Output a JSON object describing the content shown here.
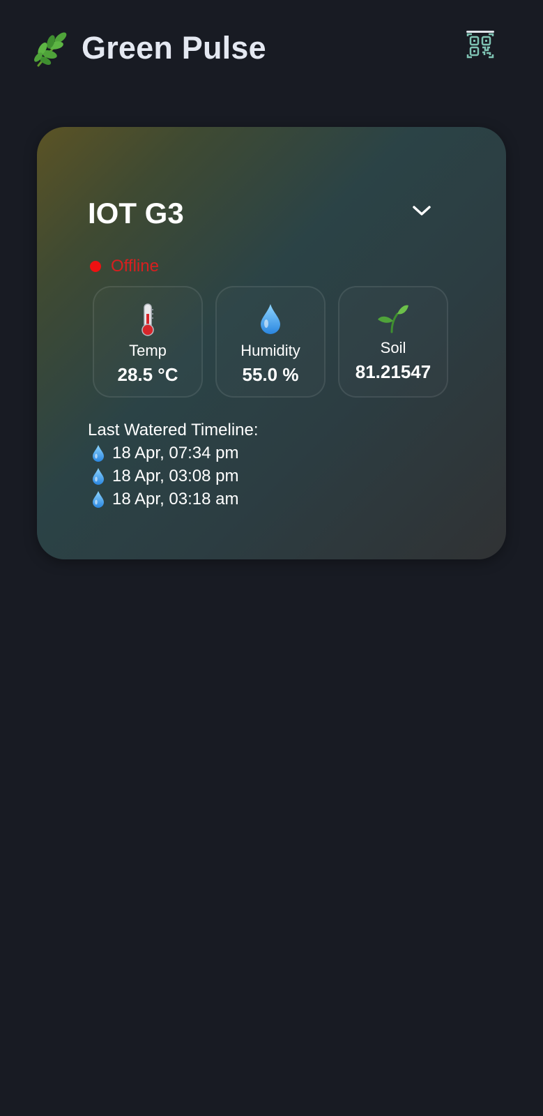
{
  "app": {
    "title": "Green Pulse",
    "logo_icon": "leaves-icon",
    "qr_icon": "qr-scan-icon"
  },
  "device": {
    "name": "IOT G3",
    "dropdown_icon": "chevron-down-icon",
    "status": {
      "label": "Offline",
      "color": "#ee1111"
    },
    "metrics": {
      "temp": {
        "icon": "thermometer-icon",
        "label": "Temp",
        "value": "28.5 °C"
      },
      "humidity": {
        "icon": "water-drop-icon",
        "label": "Humidity",
        "value": "55.0 %"
      },
      "soil": {
        "icon": "seedling-icon",
        "label": "Soil",
        "value": "81.21547"
      }
    },
    "timeline": {
      "title": "Last Watered Timeline:",
      "items": [
        "18 Apr, 07:34 pm",
        "18 Apr, 03:08 pm",
        "18 Apr, 03:18 am"
      ]
    }
  },
  "colors": {
    "background": "#181b23",
    "title_text": "#e4e8f1",
    "offline_red": "#d81f1f",
    "qr_accent": "#7fc4b4"
  }
}
